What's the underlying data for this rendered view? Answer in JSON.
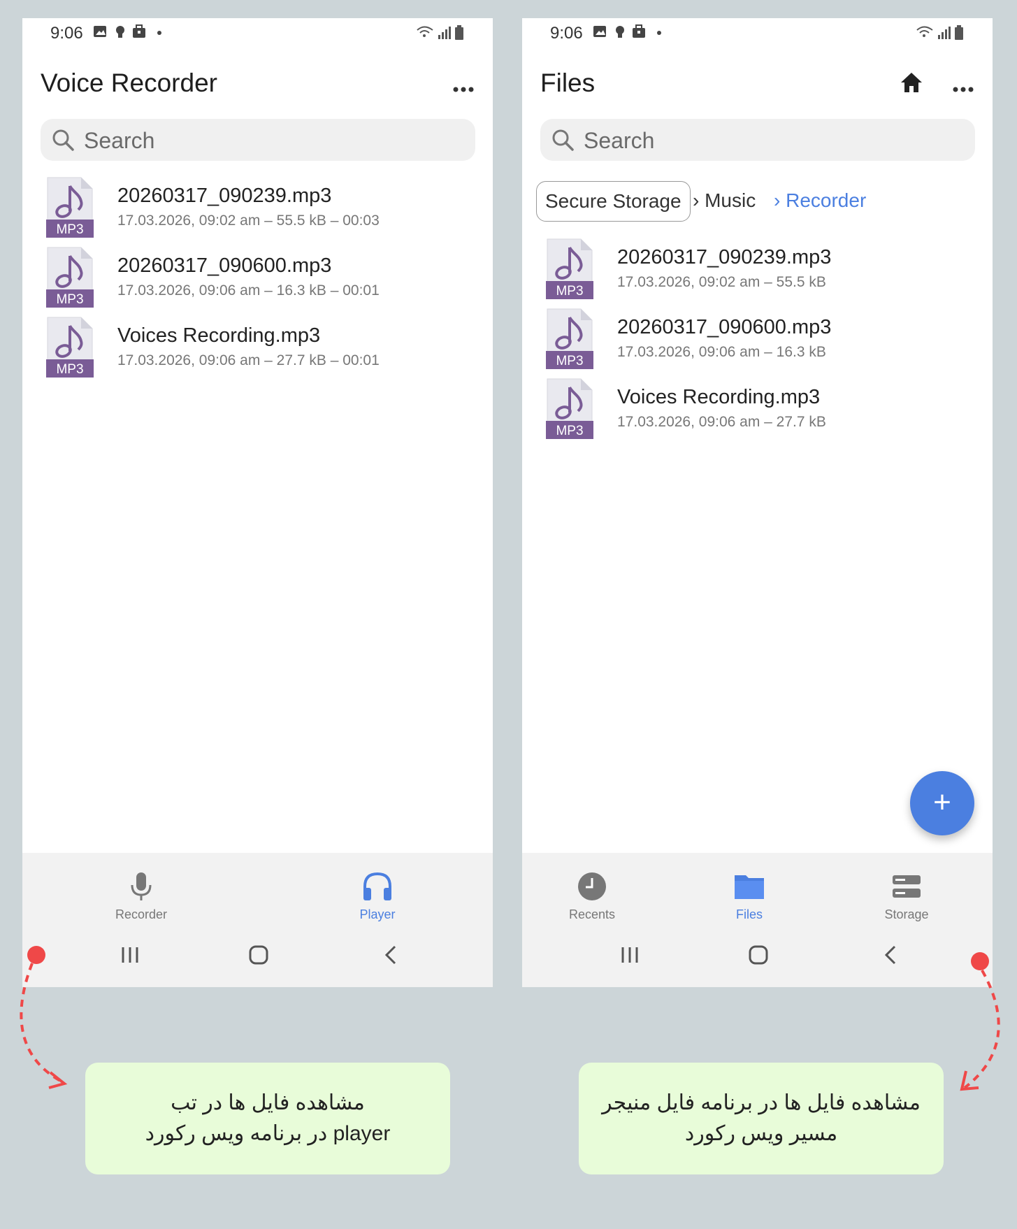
{
  "colors": {
    "accent": "#4b7fe0",
    "mp3_purple": "#7a5c96",
    "caption_bg": "#e8fcd9",
    "marker_red": "#ef4848"
  },
  "left_phone": {
    "status": {
      "time": "9:06"
    },
    "title": "Voice Recorder",
    "search": {
      "placeholder": "Search"
    },
    "files": [
      {
        "name": "20260317_090239.mp3",
        "meta": "17.03.2026, 09:02 am – 55.5 kB – 00:03",
        "badge": "MP3"
      },
      {
        "name": "20260317_090600.mp3",
        "meta": "17.03.2026, 09:06 am – 16.3 kB – 00:01",
        "badge": "MP3"
      },
      {
        "name": "Voices Recording.mp3",
        "meta": "17.03.2026, 09:06 am – 27.7 kB – 00:01",
        "badge": "MP3"
      }
    ],
    "nav": [
      {
        "label": "Recorder",
        "icon": "microphone-icon",
        "active": false
      },
      {
        "label": "Player",
        "icon": "headphones-icon",
        "active": true
      }
    ]
  },
  "right_phone": {
    "status": {
      "time": "9:06"
    },
    "title": "Files",
    "search": {
      "placeholder": "Search"
    },
    "breadcrumb": [
      "Secure Storage",
      "› Music",
      "› Recorder"
    ],
    "files": [
      {
        "name": "20260317_090239.mp3",
        "meta": "17.03.2026, 09:02 am – 55.5 kB",
        "badge": "MP3"
      },
      {
        "name": "20260317_090600.mp3",
        "meta": "17.03.2026, 09:06 am – 16.3 kB",
        "badge": "MP3"
      },
      {
        "name": "Voices Recording.mp3",
        "meta": "17.03.2026, 09:06 am – 27.7 kB",
        "badge": "MP3"
      }
    ],
    "fab": "+",
    "nav": [
      {
        "label": "Recents",
        "icon": "clock-icon",
        "active": false
      },
      {
        "label": "Files",
        "icon": "folder-icon",
        "active": true
      },
      {
        "label": "Storage",
        "icon": "storage-icon",
        "active": false
      }
    ]
  },
  "captions": {
    "left": [
      "مشاهده فایل ها در تب",
      "player در برنامه ویس رکورد"
    ],
    "right": [
      "مشاهده فایل ها در برنامه فایل منیجر",
      "مسیر ویس رکورد"
    ]
  }
}
